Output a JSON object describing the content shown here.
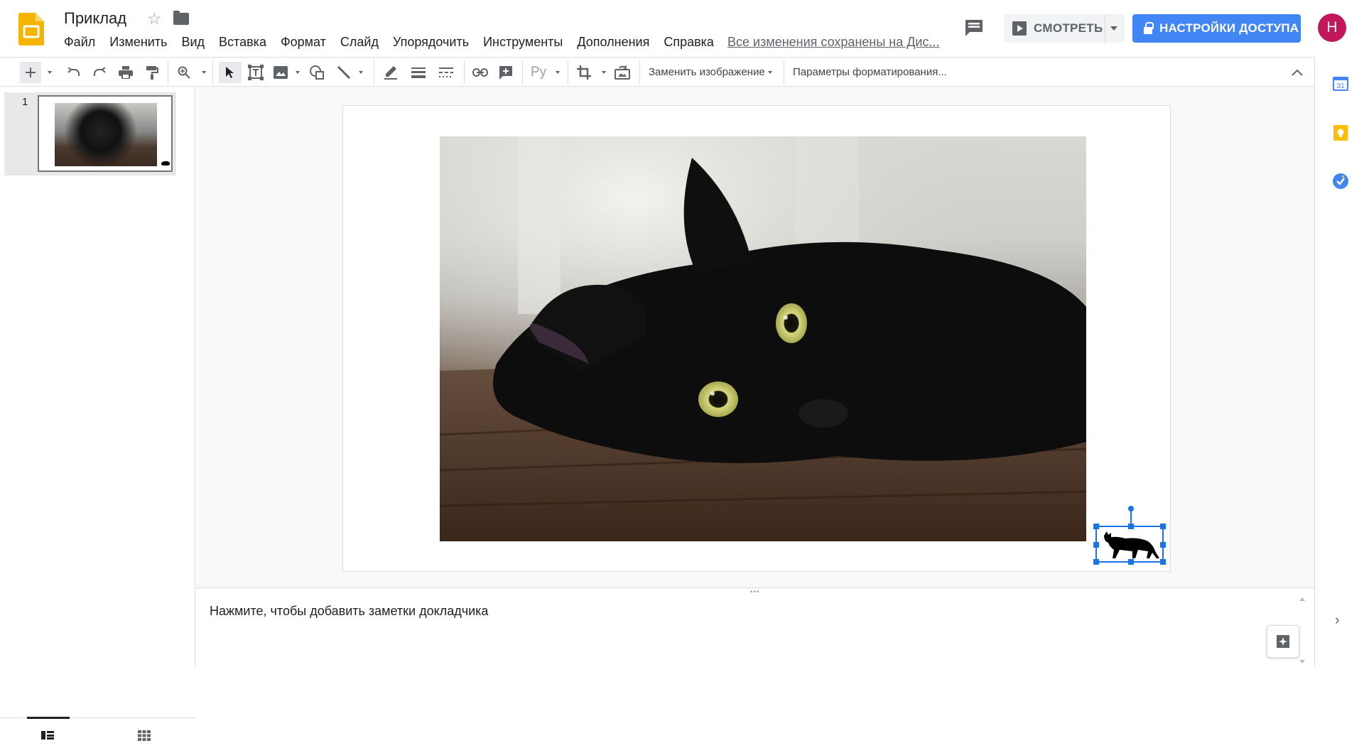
{
  "app": {
    "doc_title": "Приклад",
    "saved_status": "Все изменения сохранены на Дис...",
    "avatar_letter": "Н",
    "view_button": "СМОТРЕТЬ",
    "share_button": "НАСТРОЙКИ ДОСТУПА",
    "brand_color": "#f4b400",
    "accent_color": "#4285f4"
  },
  "menu": {
    "items": [
      "Файл",
      "Изменить",
      "Вид",
      "Вставка",
      "Формат",
      "Слайд",
      "Упорядочить",
      "Инструменты",
      "Дополнения",
      "Справка"
    ]
  },
  "toolbar": {
    "replace_image": "Заменить изображение",
    "format_options": "Параметры форматирования...",
    "lang_label": "Ру"
  },
  "slides": {
    "items": [
      {
        "number": "1"
      }
    ]
  },
  "notes": {
    "placeholder": "Нажмите, чтобы добавить заметки докладчика"
  },
  "icons": {
    "right_panel": [
      "calendar-icon",
      "keep-icon",
      "tasks-icon"
    ],
    "calendar_day": "31"
  }
}
